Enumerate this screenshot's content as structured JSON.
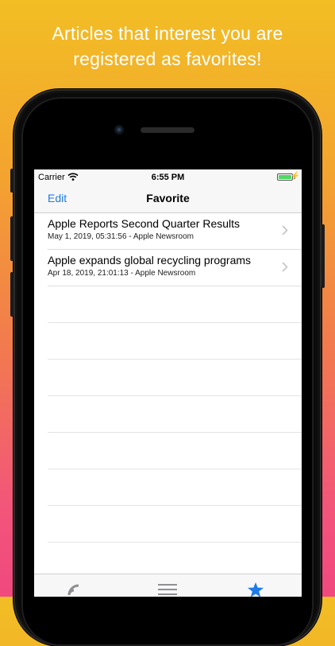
{
  "promo": {
    "line1": "Articles that interest you are",
    "line2": "registered as favorites!"
  },
  "status_bar": {
    "carrier": "Carrier",
    "time": "6:55 PM",
    "battery_color": "#4CD964"
  },
  "nav": {
    "edit_label": "Edit",
    "title": "Favorite",
    "accent_color": "#1E7BE8"
  },
  "favorites": [
    {
      "title": "Apple Reports Second Quarter Results",
      "subtitle": "May 1, 2019, 05:31:56 - Apple Newsroom"
    },
    {
      "title": "Apple expands global recycling programs",
      "subtitle": "Apr 18, 2019, 21:01:13 - Apple Newsroom"
    }
  ],
  "tab_bar": {
    "tabs": [
      {
        "icon": "rss-feed-icon"
      },
      {
        "icon": "list-icon"
      },
      {
        "icon": "star-icon",
        "selected": true
      }
    ],
    "selected_color": "#1E7BE8",
    "unselected_color": "#8E8E93"
  }
}
